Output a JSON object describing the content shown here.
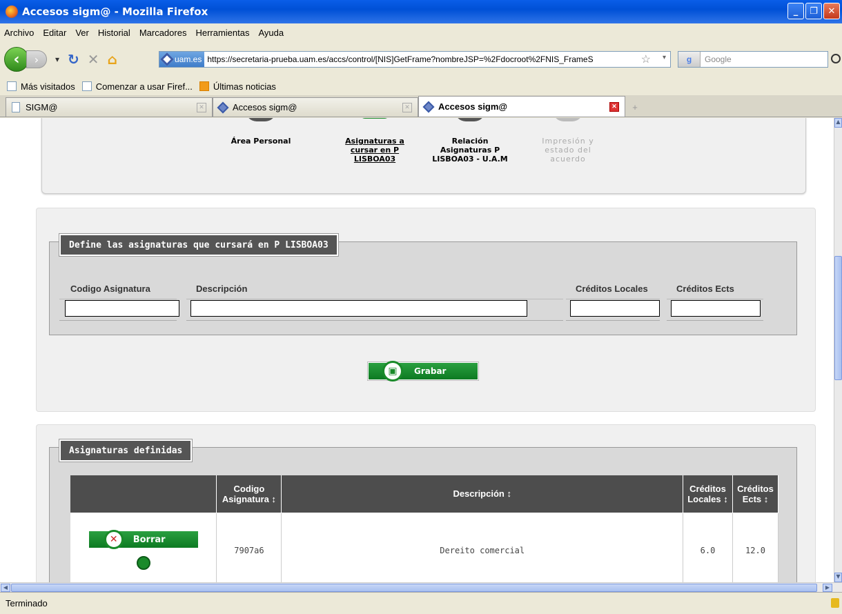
{
  "window": {
    "title": "Accesos sigm@ - Mozilla Firefox"
  },
  "menu": [
    "Archivo",
    "Editar",
    "Ver",
    "Historial",
    "Marcadores",
    "Herramientas",
    "Ayuda"
  ],
  "nav": {
    "site_badge": "uam.es",
    "url": "https://secretaria-prueba.uam.es/accs/control/[NIS]GetFrame?nombreJSP=%2Fdocroot%2FNIS_FrameS",
    "search_placeholder": "Google"
  },
  "bookmarks": [
    "Más visitados",
    "Comenzar a usar Firef...",
    "Últimas noticias"
  ],
  "tabs": [
    {
      "label": "SIGM@"
    },
    {
      "label": "Accesos sigm@"
    },
    {
      "label": "Accesos sigm@"
    }
  ],
  "steps": [
    {
      "label": "Área Personal"
    },
    {
      "label": "Asignaturas a cursar en P LISBOA03"
    },
    {
      "label": "Relación Asignaturas P LISBOA03 - U.A.M"
    },
    {
      "label": "Impresión y estado del acuerdo"
    }
  ],
  "define": {
    "legend": "Define las asignaturas que cursará en P LISBOA03",
    "col_codigo": "Codigo Asignatura",
    "col_descripcion": "Descripción",
    "col_creditos_locales": "Créditos Locales",
    "col_creditos_ects": "Créditos Ects",
    "save_label": "Grabar"
  },
  "defined": {
    "legend": "Asignaturas definidas",
    "headers": {
      "codigo": "Codigo Asignatura ↕",
      "descripcion": "Descripción ↕",
      "locales": "Créditos Locales ↕",
      "ects": "Créditos Ects ↕"
    },
    "rows": [
      {
        "delete_label": "Borrar",
        "codigo": "7907a6",
        "descripcion": "Dereito comercial",
        "locales": "6.0",
        "ects": "12.0"
      }
    ]
  },
  "status": "Terminado",
  "colors": {
    "accent_green": "#1a8a2a",
    "header_gray": "#4d4d4d",
    "xp_blue": "#0a5ee8"
  }
}
